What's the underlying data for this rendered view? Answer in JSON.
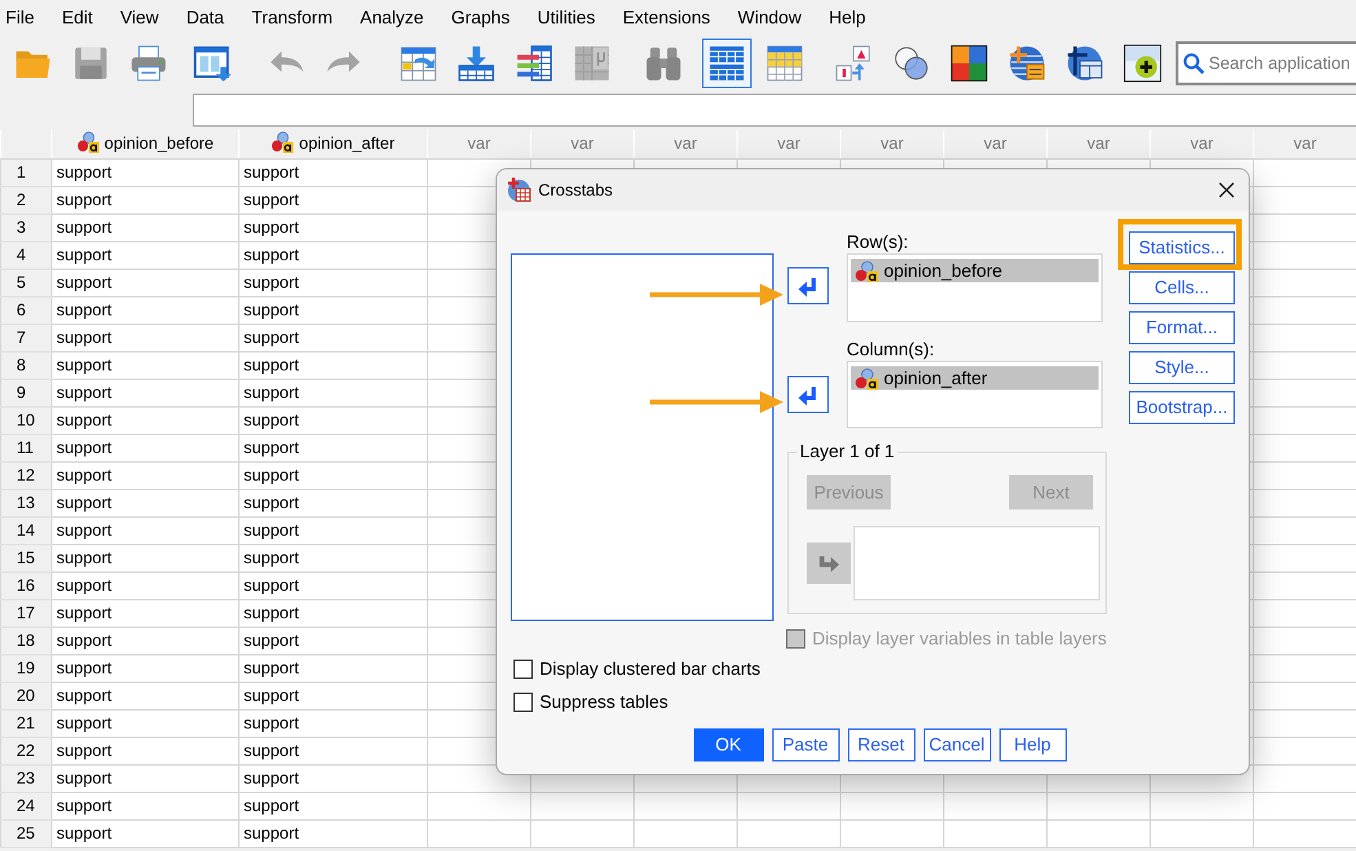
{
  "menu": [
    "File",
    "Edit",
    "View",
    "Data",
    "Transform",
    "Analyze",
    "Graphs",
    "Utilities",
    "Extensions",
    "Window",
    "Help"
  ],
  "toolbar": {
    "buttons": [
      {
        "kind": "open",
        "disabled": false,
        "pressed": false
      },
      {
        "kind": "save",
        "disabled": true,
        "pressed": false
      },
      {
        "kind": "print",
        "disabled": false,
        "pressed": false
      },
      {
        "kind": "recall",
        "disabled": false,
        "pressed": false
      },
      {
        "kind": "undo",
        "disabled": true,
        "pressed": false
      },
      {
        "kind": "redo",
        "disabled": true,
        "pressed": false
      },
      {
        "kind": "gotocase",
        "disabled": false,
        "pressed": false
      },
      {
        "kind": "insertcases",
        "disabled": false,
        "pressed": false
      },
      {
        "kind": "variables",
        "disabled": false,
        "pressed": false
      },
      {
        "kind": "formula",
        "disabled": true,
        "pressed": false
      },
      {
        "kind": "find",
        "disabled": true,
        "pressed": false
      },
      {
        "kind": "dataview",
        "disabled": false,
        "pressed": true
      },
      {
        "kind": "yellowgrid",
        "disabled": false,
        "pressed": false
      },
      {
        "kind": "labels",
        "disabled": false,
        "pressed": false
      },
      {
        "kind": "circles",
        "disabled": false,
        "pressed": false
      },
      {
        "kind": "colors",
        "disabled": false,
        "pressed": false
      },
      {
        "kind": "globeplus",
        "disabled": false,
        "pressed": false
      },
      {
        "kind": "globecross",
        "disabled": false,
        "pressed": false
      },
      {
        "kind": "extension",
        "disabled": false,
        "pressed": false
      }
    ],
    "search": {
      "placeholder": "Search application"
    }
  },
  "data_editor": {
    "columns": [
      {
        "label": "opinion_before",
        "kind": "variable"
      },
      {
        "label": "opinion_after",
        "kind": "variable"
      },
      {
        "label": "var",
        "kind": "empty"
      },
      {
        "label": "var",
        "kind": "empty"
      },
      {
        "label": "var",
        "kind": "empty"
      },
      {
        "label": "var",
        "kind": "empty"
      },
      {
        "label": "var",
        "kind": "empty"
      },
      {
        "label": "var",
        "kind": "empty"
      },
      {
        "label": "var",
        "kind": "empty"
      },
      {
        "label": "var",
        "kind": "empty"
      },
      {
        "label": "var",
        "kind": "empty"
      }
    ],
    "rows": [
      {
        "number": "1",
        "cells": [
          "support",
          "support"
        ]
      },
      {
        "number": "2",
        "cells": [
          "support",
          "support"
        ]
      },
      {
        "number": "3",
        "cells": [
          "support",
          "support"
        ]
      },
      {
        "number": "4",
        "cells": [
          "support",
          "support"
        ]
      },
      {
        "number": "5",
        "cells": [
          "support",
          "support"
        ]
      },
      {
        "number": "6",
        "cells": [
          "support",
          "support"
        ]
      },
      {
        "number": "7",
        "cells": [
          "support",
          "support"
        ]
      },
      {
        "number": "8",
        "cells": [
          "support",
          "support"
        ]
      },
      {
        "number": "9",
        "cells": [
          "support",
          "support"
        ]
      },
      {
        "number": "10",
        "cells": [
          "support",
          "support"
        ]
      },
      {
        "number": "11",
        "cells": [
          "support",
          "support"
        ]
      },
      {
        "number": "12",
        "cells": [
          "support",
          "support"
        ]
      },
      {
        "number": "13",
        "cells": [
          "support",
          "support"
        ]
      },
      {
        "number": "14",
        "cells": [
          "support",
          "support"
        ]
      },
      {
        "number": "15",
        "cells": [
          "support",
          "support"
        ]
      },
      {
        "number": "16",
        "cells": [
          "support",
          "support"
        ]
      },
      {
        "number": "17",
        "cells": [
          "support",
          "support"
        ]
      },
      {
        "number": "18",
        "cells": [
          "support",
          "support"
        ]
      },
      {
        "number": "19",
        "cells": [
          "support",
          "support"
        ]
      },
      {
        "number": "20",
        "cells": [
          "support",
          "support"
        ]
      },
      {
        "number": "21",
        "cells": [
          "support",
          "support"
        ]
      },
      {
        "number": "22",
        "cells": [
          "support",
          "support"
        ]
      },
      {
        "number": "23",
        "cells": [
          "support",
          "support"
        ]
      },
      {
        "number": "24",
        "cells": [
          "support",
          "support"
        ]
      },
      {
        "number": "25",
        "cells": [
          "support",
          "support"
        ]
      }
    ]
  },
  "dialog": {
    "title": "Crosstabs",
    "row_box": {
      "label": "Row(s):",
      "move_button": {
        "disabled": false,
        "annotated": true
      },
      "items": [
        {
          "label": "opinion_before",
          "selected": true
        }
      ]
    },
    "column_box": {
      "label": "Column(s):",
      "move_button": {
        "disabled": false,
        "annotated": true
      },
      "items": [
        {
          "label": "opinion_after",
          "selected": true
        }
      ]
    },
    "side_buttons": [
      {
        "label": "Statistics...",
        "highlighted": true
      },
      {
        "label": "Cells...",
        "highlighted": false
      },
      {
        "label": "Format...",
        "highlighted": false
      },
      {
        "label": "Style...",
        "highlighted": false
      },
      {
        "label": "Bootstrap...",
        "highlighted": false
      }
    ],
    "layer": {
      "title": "Layer 1 of 1",
      "previous": {
        "label": "Previous",
        "disabled": true
      },
      "next": {
        "label": "Next",
        "disabled": true
      },
      "move_button": {
        "disabled": true
      }
    },
    "layer_option": {
      "label": "Display layer variables in table layers",
      "checked": false,
      "disabled": true
    },
    "options": [
      {
        "label": "Display clustered bar charts",
        "checked": false
      },
      {
        "label": "Suppress tables",
        "checked": false
      }
    ],
    "buttons": [
      {
        "label": "OK",
        "kind": "primary"
      },
      {
        "label": "Paste",
        "kind": "normal"
      },
      {
        "label": "Reset",
        "kind": "normal"
      },
      {
        "label": "Cancel",
        "kind": "normal"
      },
      {
        "label": "Help",
        "kind": "normal"
      }
    ]
  }
}
